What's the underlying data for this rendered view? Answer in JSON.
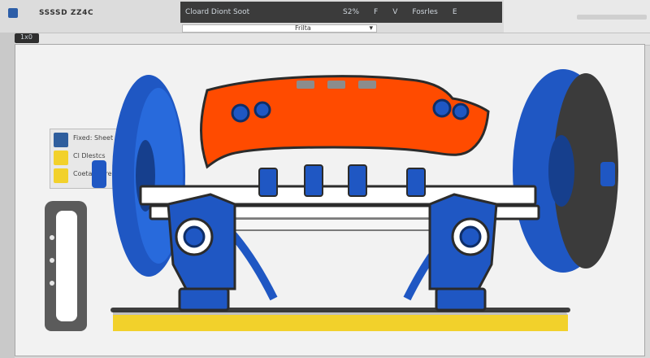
{
  "titlebar": {
    "app_title": "SSSSD ZZ4C",
    "tab_label": "1x0"
  },
  "toolbar": {
    "left_text": "Cloard Diont Soot",
    "right_items": [
      "S2%",
      "F",
      "V",
      "Fosrles",
      "E"
    ],
    "dropdown": {
      "value": "Frilta",
      "placeholder": ""
    }
  },
  "panel": {
    "items": [
      {
        "label": "Fixed: Sheet"
      },
      {
        "label": "Cl Dlestcs"
      },
      {
        "label": "Coetatl Strenr"
      }
    ]
  },
  "colors": {
    "accent": "#ff4b00",
    "blue": "#1f57c3",
    "yellow": "#f2d12b"
  }
}
